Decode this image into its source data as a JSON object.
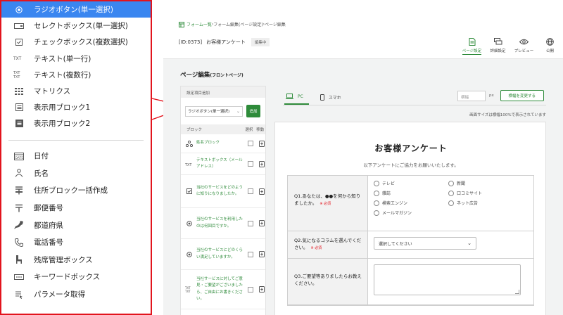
{
  "dropdown": {
    "group1": [
      {
        "label": "ラジオボタン(単一選択)",
        "icon": "radio-icon",
        "selected": true
      },
      {
        "label": "セレクトボックス(単一選択)",
        "icon": "select-box-icon"
      },
      {
        "label": "チェックボックス(複数選択)",
        "icon": "checkbox-icon"
      },
      {
        "label": "テキスト(単一行)",
        "icon": "text-single-icon"
      },
      {
        "label": "テキスト(複数行)",
        "icon": "text-multi-icon"
      },
      {
        "label": "マトリクス",
        "icon": "matrix-icon"
      },
      {
        "label": "表示用ブロック1",
        "icon": "display-block-icon"
      },
      {
        "label": "表示用ブロック2",
        "icon": "display-block-filled-icon"
      }
    ],
    "group2": [
      {
        "label": "日付",
        "icon": "date-icon"
      },
      {
        "label": "氏名",
        "icon": "person-icon"
      },
      {
        "label": "住所ブロック一括作成",
        "icon": "address-icon"
      },
      {
        "label": "郵便番号",
        "icon": "postal-icon"
      },
      {
        "label": "都道府県",
        "icon": "prefecture-icon"
      },
      {
        "label": "電話番号",
        "icon": "phone-icon"
      },
      {
        "label": "残席管理ボックス",
        "icon": "seat-icon"
      },
      {
        "label": "キーワードボックス",
        "icon": "keyword-icon"
      },
      {
        "label": "パラメータ取得",
        "icon": "parameter-icon"
      }
    ],
    "icon_text": {
      "text": "TEXT",
      "date": "DATE"
    }
  },
  "breadcrumb": {
    "item1": "フォーム一覧",
    "item2": "フォーム編集(ページ設定)",
    "item3": "ページ編集"
  },
  "form": {
    "id": "[ID:0373]",
    "name": "お客様アンケート",
    "status": "編集中"
  },
  "topnav": {
    "page_settings": "ページ設定",
    "detail_settings": "詳細設定",
    "preview": "プレビュー",
    "publish": "公開"
  },
  "section": {
    "title": "ページ編集",
    "subtitle": "(フロントページ)"
  },
  "settings": {
    "header": "設定項目追加",
    "select_value": "ラジオボタン(単一選択)",
    "add_label": "追加",
    "col_block": "ブロック",
    "col_select": "選択",
    "col_move": "移動",
    "blocks": [
      {
        "text": "姓名ブロック"
      },
      {
        "text": "テキストボックス（メールアドレス）"
      },
      {
        "text": "当社のサービスをどのように知りになりましたか。"
      },
      {
        "text": "当社のサービスを利用したのは何回目ですか。"
      },
      {
        "text": "当社のサービスにどのくらい満足していますか。"
      },
      {
        "text": "当社サービスに対してご意見・ご要望がございましたら、ご自由にお書きください。"
      }
    ]
  },
  "preview": {
    "tab_pc": "PC",
    "tab_phone": "スマホ",
    "width_placeholder": "横幅",
    "width_unit": "px",
    "width_button": "横幅を変更する",
    "note": "画面サイズは横幅100%で表示されています",
    "title": "お客様アンケート",
    "subtitle": "以下アンケートにご協力をお願いいたします。",
    "required": "※ 必須",
    "q1": {
      "label": "Q1.あなたは、●●を何から知りましたか。",
      "options": [
        "テレビ",
        "新聞",
        "雑誌",
        "口コミサイト",
        "検索エンジン",
        "ネット広告",
        "メールマガジン"
      ]
    },
    "q2": {
      "label": "Q2.気になるコラムを選んでください。",
      "select": "選択してください"
    },
    "q3": {
      "label": "Q3.ご要望等ありましたらお教えください。"
    }
  },
  "colors": {
    "accent_green": "#2e8b3a",
    "highlight_red": "#e2141d",
    "selected_blue": "#3a86f0"
  }
}
